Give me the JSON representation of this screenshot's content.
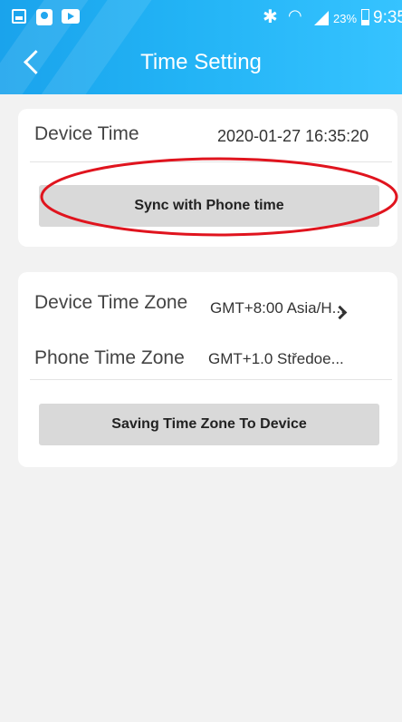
{
  "status_bar": {
    "battery_percent": "23%",
    "time": "9:35",
    "icons": [
      "gallery-icon",
      "location-icon",
      "video-icon",
      "bluetooth-icon",
      "wifi-icon",
      "signal-icon",
      "battery-icon"
    ]
  },
  "header": {
    "title": "Time Setting",
    "back_icon": "chevron-left-icon"
  },
  "device_time_card": {
    "label": "Device Time",
    "value": "2020-01-27 16:35:20",
    "sync_button": "Sync with Phone time"
  },
  "timezone_card": {
    "device_tz_label": "Device Time Zone",
    "device_tz_value": "GMT+8:00 Asia/H...",
    "phone_tz_label": "Phone Time Zone",
    "phone_tz_value": "GMT+1.0  Středoe...",
    "save_button": "Saving Time Zone To Device"
  },
  "colors": {
    "header_start": "#1aa3ec",
    "header_end": "#36c3ff",
    "annotation": "#e0141e",
    "background": "#f2f2f2"
  }
}
